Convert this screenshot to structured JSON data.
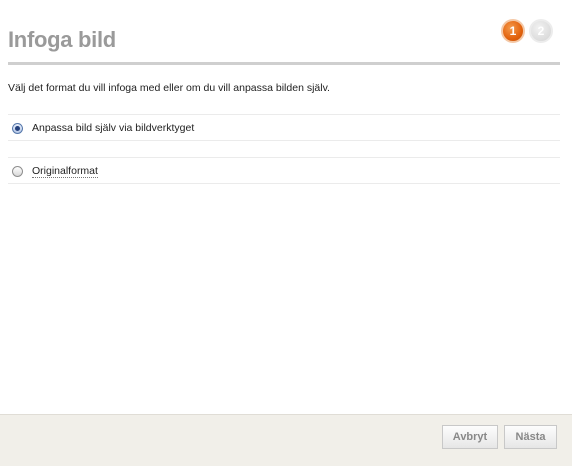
{
  "dialog": {
    "title": "Infoga bild",
    "steps": [
      {
        "label": "1",
        "active": true
      },
      {
        "label": "2",
        "active": false
      }
    ],
    "instruction": "Välj det format du vill infoga med eller om du vill anpassa bilden själv.",
    "options": [
      {
        "label": "Anpassa bild själv via bildverktyget",
        "checked": true
      },
      {
        "label": "Originalformat",
        "checked": false
      }
    ],
    "buttons": {
      "cancel_label": "Avbryt",
      "next_label": "Nästa"
    }
  },
  "colors": {
    "accent": "#e2620d",
    "title": "#9a9a9a",
    "footer_bg": "#f1efe9"
  }
}
